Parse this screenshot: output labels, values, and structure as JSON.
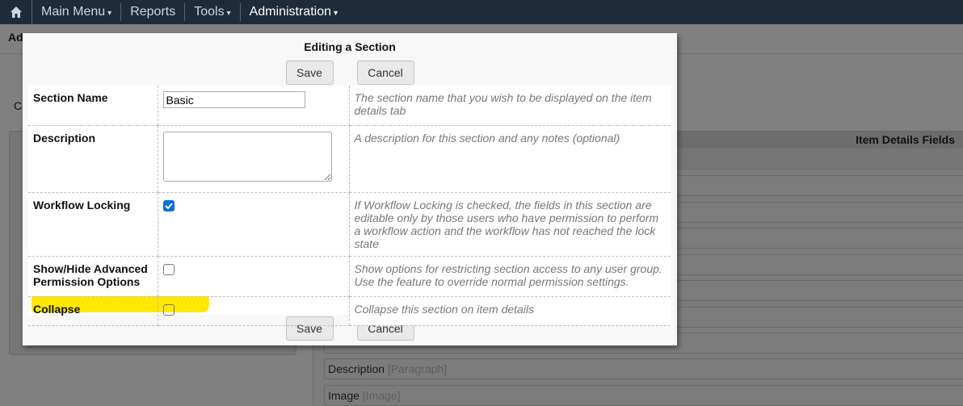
{
  "nav": {
    "items": [
      {
        "label": "Main Menu",
        "caret": true
      },
      {
        "label": "Reports",
        "caret": false
      },
      {
        "label": "Tools",
        "caret": true
      },
      {
        "label": "Administration",
        "caret": true
      }
    ]
  },
  "background": {
    "page_heading_partial": "Ad",
    "left_text_partial": "C",
    "right_panel_title": "Item Details Fields",
    "fields": [
      {
        "name": "Description",
        "type": "[Paragraph]"
      },
      {
        "name": "Image",
        "type": "[Image]"
      }
    ]
  },
  "dialog": {
    "title": "Editing a Section",
    "save_label": "Save",
    "cancel_label": "Cancel",
    "rows": [
      {
        "label": "Section Name",
        "value": "Basic",
        "help": "The section name that you wish to be displayed on the item details tab"
      },
      {
        "label": "Description",
        "value": "",
        "help": "A description for this section and any notes (optional)"
      },
      {
        "label": "Workflow Locking",
        "checked": true,
        "help": "If Workflow Locking is checked, the fields in this section are editable only by those users who have permission to perform a workflow action and the workflow has not reached the lock state"
      },
      {
        "label": "Show/Hide Advanced Permission Options",
        "checked": false,
        "help": "Show options for restricting section access to any user group. Use the feature to override normal permission settings."
      },
      {
        "label": "Collapse",
        "checked": false,
        "help": "Collapse this section on item details"
      }
    ]
  },
  "colors": {
    "highlight": "#ffe800",
    "checkbox_on": "#0a6ddf",
    "nav_bg": "#1f2b38"
  }
}
